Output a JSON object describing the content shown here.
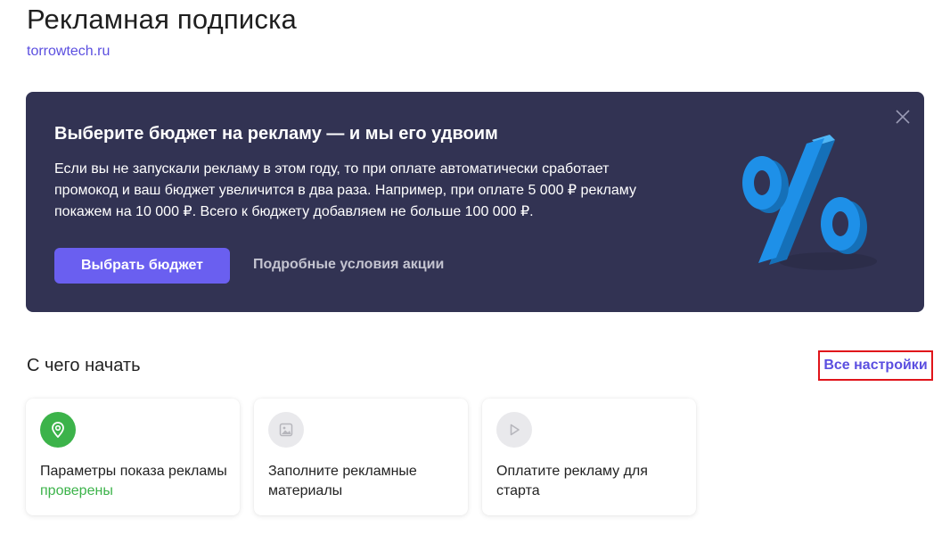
{
  "header": {
    "title": "Рекламная подписка",
    "site": "torrowtech.ru"
  },
  "promo": {
    "title": "Выберите бюджет на рекламу — и мы его удвоим",
    "text_lines": [
      "Если вы не запускали рекламу в этом году, то при оплате автоматически сработает",
      "промокод и ваш бюджет увеличится в два раза. Например, при оплате 5 000 ₽ рекламу",
      "покажем на 10 000 ₽. Всего к бюджету добавляем не больше 100 000 ₽."
    ],
    "primary_button": "Выбрать бюджет",
    "secondary_link": "Подробные условия акции",
    "background_color": "#323353",
    "accent_color": "#6a5ff0"
  },
  "start": {
    "title": "С чего начать",
    "all_settings": "Все настройки",
    "cards": [
      {
        "icon": "location-pin-icon",
        "text": "Параметры показа рекламы",
        "status": "проверены",
        "status_color": "#3cb34a"
      },
      {
        "icon": "image-icon",
        "text": "Заполните рекламные материалы",
        "status": ""
      },
      {
        "icon": "play-icon",
        "text": "Оплатите рекламу для старта",
        "status": ""
      }
    ]
  }
}
